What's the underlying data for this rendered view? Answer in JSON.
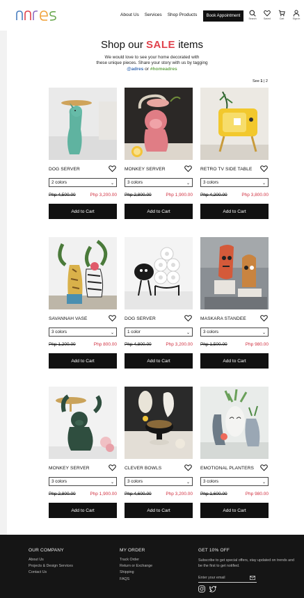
{
  "header": {
    "logo_text": "adres",
    "nav": [
      "About Us",
      "Services",
      "Shop Products"
    ],
    "book_button": "Book Appointment",
    "icons": [
      {
        "name": "search-icon",
        "label": "Search"
      },
      {
        "name": "heart-icon",
        "label": "Saved"
      },
      {
        "name": "cart-icon",
        "label": "Cart"
      },
      {
        "name": "user-icon",
        "label": "Sign in"
      }
    ]
  },
  "hero": {
    "title_pre": "Shop our",
    "title_sale": "SALE",
    "title_post": "items",
    "subtitle_line1": "We would love to see your home decorated with",
    "subtitle_line2": "these unique pieces.  Share your story with us by tagging",
    "tag1": "@adres",
    "tag_or": "or",
    "tag2": "#homeadres"
  },
  "pagination": {
    "label": "See",
    "current": "1",
    "sep": "|",
    "next": "2"
  },
  "products": [
    {
      "name": "DOG SERVER",
      "option": "2 colors",
      "old_price": "Php 4,500.00",
      "new_price": "Php 3,200.00",
      "button": "Add to Cart"
    },
    {
      "name": "MONKEY SERVER",
      "option": "3 colors",
      "old_price": "Php 2,800.00",
      "new_price": "Php 1,900.00",
      "button": "Add to Cart"
    },
    {
      "name": "RETRO TV SIDE TABLE",
      "option": "3 colors",
      "old_price": "Php 4,200.00",
      "new_price": "Php 3,800.00",
      "button": "Add to Cart"
    },
    {
      "name": "SAVANNAH VASE",
      "option": "3 colors",
      "old_price": "Php 1,200.00",
      "new_price": "Php 800.00",
      "button": "Add to Cart"
    },
    {
      "name": "DOG SERVER",
      "option": "1 color",
      "old_price": "Php 4,800.00",
      "new_price": "Php 3,200.00",
      "button": "Add to Cart"
    },
    {
      "name": "MASKARA STANDEE",
      "option": "3 colors",
      "old_price": "Php 1,500.00",
      "new_price": "Php 980.00",
      "button": "Add to Cart"
    },
    {
      "name": "MONKEY SERVER",
      "option": "3 colors",
      "old_price": "Php 2,800.00",
      "new_price": "Php 1,900.00",
      "button": "Add to Cart"
    },
    {
      "name": "CLEVER BOWLS",
      "option": "3 colors",
      "old_price": "Php 4,600.00",
      "new_price": "Php 3,200.00",
      "button": "Add to Cart"
    },
    {
      "name": "EMOTIONAL PLANTERS",
      "option": "3 colors",
      "old_price": "Php 1,600.00",
      "new_price": "Php 980.00",
      "button": "Add to Cart"
    }
  ],
  "footer": {
    "col1": {
      "title": "OUR COMPANY",
      "links": [
        "About Us",
        "Projects & Design Services",
        "Contact Us"
      ]
    },
    "col2": {
      "title": "MY ORDER",
      "links": [
        "Track Order",
        "Return or Exchange",
        "Shipping",
        "FAQS"
      ]
    },
    "col3": {
      "title": "GET 10% OFF",
      "desc": "Subscribe to get special offers, stay updated on trends and be the first to get notified.",
      "email_placeholder": "Enter your email",
      "social": [
        "instagram-icon",
        "twitter-icon"
      ]
    }
  },
  "colors": {
    "accent": "#e0424c",
    "price_red": "#d03040",
    "tag_blue": "#3b6db5",
    "tag_green": "#6aa84f",
    "footer_bg": "#151515"
  }
}
